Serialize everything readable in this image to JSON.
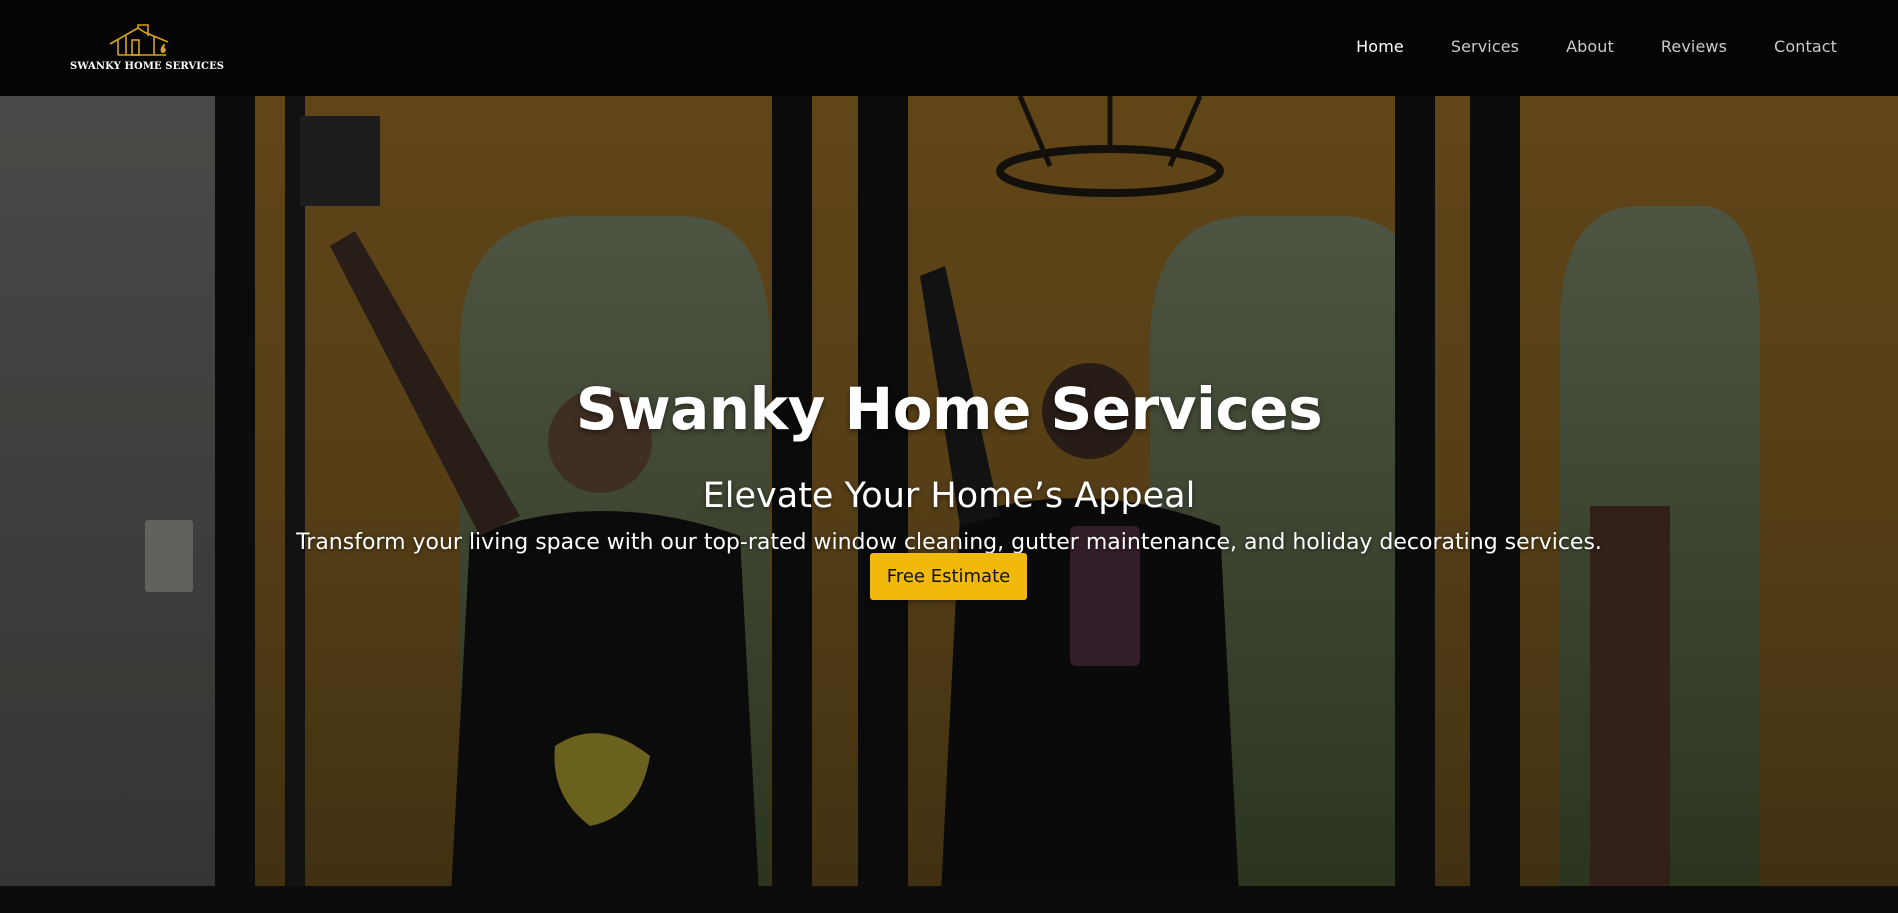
{
  "header": {
    "logo_text": "SWANKY HOME SERVICES",
    "nav": [
      {
        "label": "Home",
        "active": true
      },
      {
        "label": "Services",
        "active": false
      },
      {
        "label": "About",
        "active": false
      },
      {
        "label": "Reviews",
        "active": false
      },
      {
        "label": "Contact",
        "active": false
      }
    ]
  },
  "hero": {
    "title": "Swanky Home Services",
    "subtitle": "Elevate Your Home’s Appeal",
    "description": "Transform your living space with our top-rated window cleaning, gutter maintenance, and holiday decorating services.",
    "cta_label": "Free Estimate",
    "background_image": "photo-two-window-cleaners-waving"
  },
  "colors": {
    "header_bg": "#050505",
    "accent": "#f0b90b",
    "logo_gold": "#d9a21b",
    "text": "#ffffff",
    "nav_text": "#c9c9c9"
  }
}
